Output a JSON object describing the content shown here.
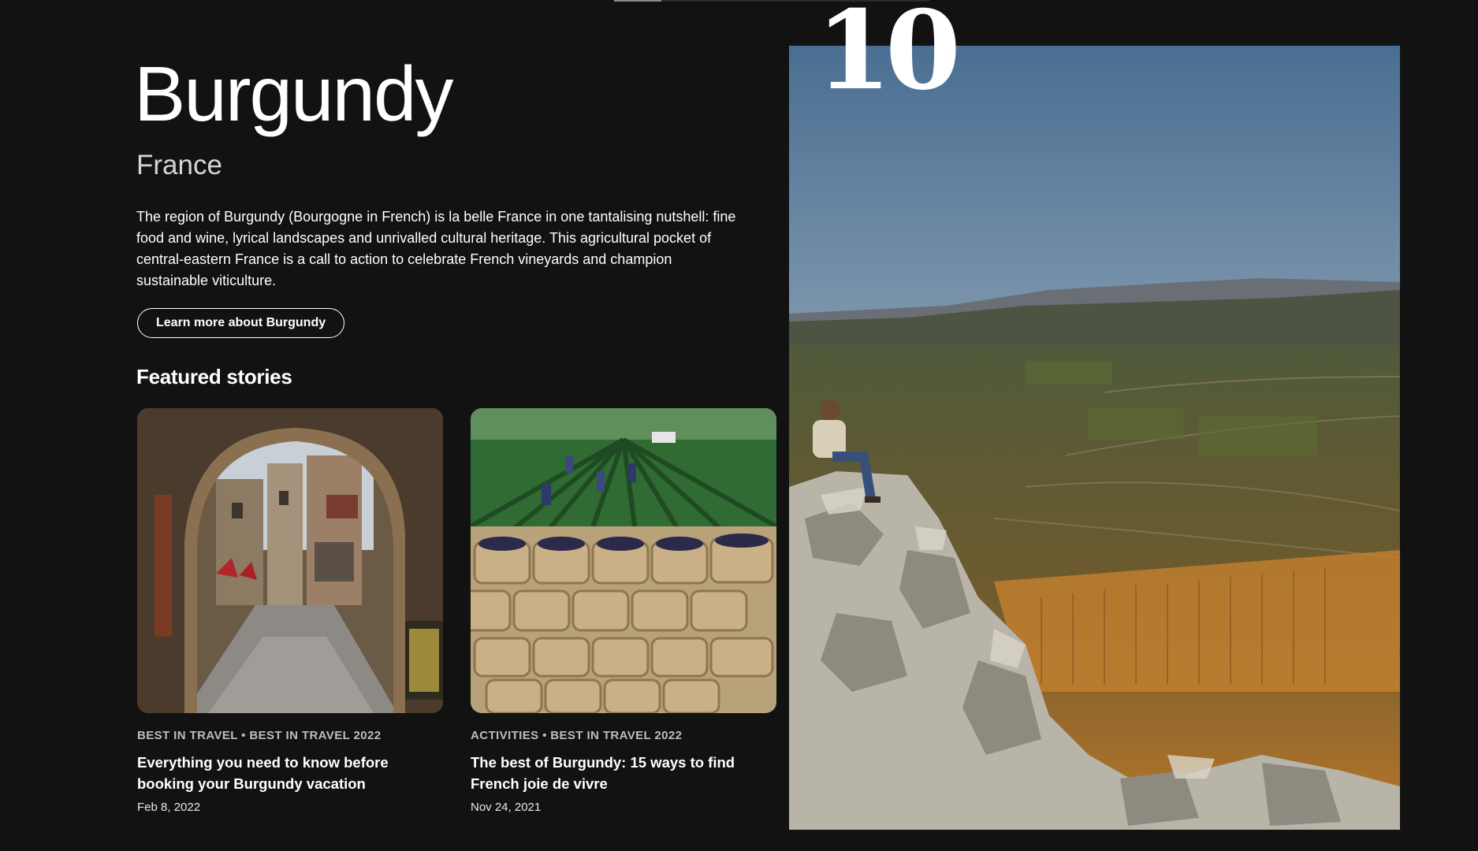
{
  "progress": {
    "fraction": 0.15
  },
  "destination": {
    "rank": "10",
    "name": "Burgundy",
    "country": "France",
    "description": "The region of Burgundy (Bourgogne in French) is la belle France in one tantalising nutshell: fine food and wine, lyrical landscapes and unrivalled cultural heritage. This agricultural pocket of central-eastern France is a call to action to celebrate French vineyards and champion sustainable viticulture.",
    "learn_more_label": "Learn more about Burgundy"
  },
  "featured": {
    "heading": "Featured stories",
    "stories": [
      {
        "tags": "BEST IN TRAVEL • BEST IN TRAVEL 2022",
        "title": "Everything you need to know before booking your Burgundy vacation",
        "date": "Feb 8, 2022"
      },
      {
        "tags": "ACTIVITIES • BEST IN TRAVEL 2022",
        "title": "The best of Burgundy: 15 ways to find French joie de vivre",
        "date": "Nov 24, 2021"
      }
    ]
  }
}
